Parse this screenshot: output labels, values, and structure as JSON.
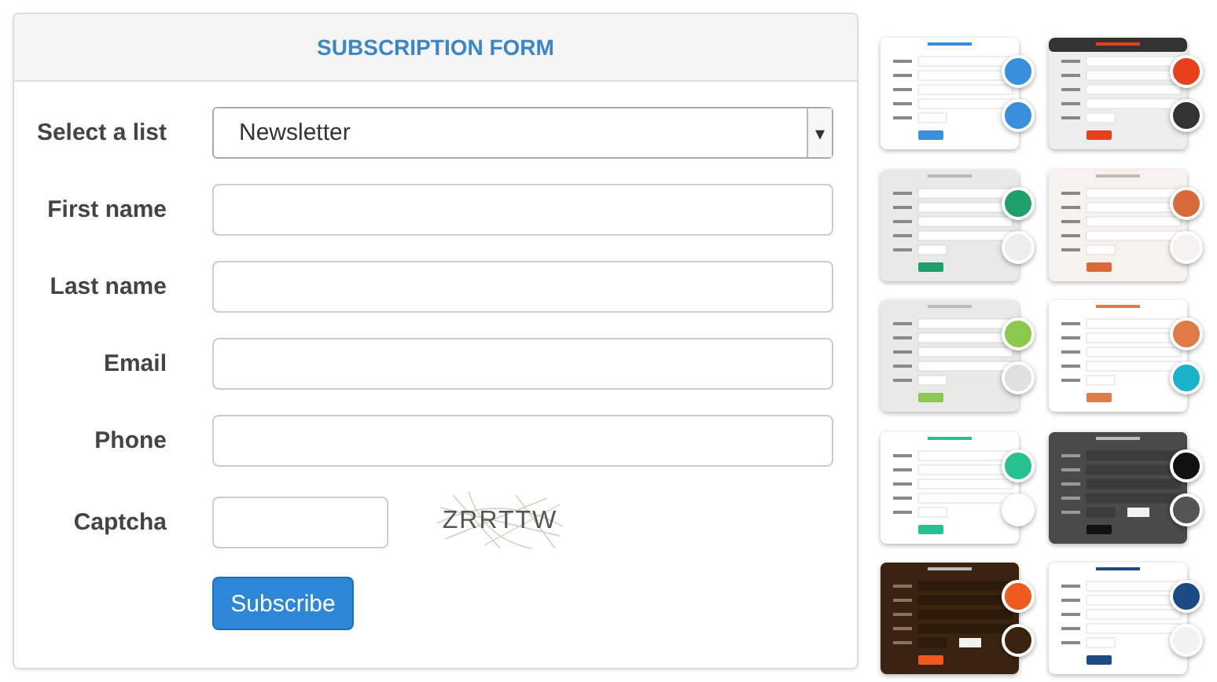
{
  "form": {
    "title": "SUBSCRIPTION FORM",
    "list_field": {
      "label": "Select a list",
      "value": "Newsletter",
      "caret": "▾"
    },
    "fields": [
      {
        "label": "First name"
      },
      {
        "label": "Last name"
      },
      {
        "label": "Email"
      },
      {
        "label": "Phone"
      }
    ],
    "captcha": {
      "label": "Captcha",
      "code": "ZRRTTW"
    },
    "submit": "Subscribe"
  },
  "themes": [
    {
      "kind": "light",
      "swatches": [
        {
          "color": "#3a8fdc"
        },
        {
          "color": "#3a8fdc"
        }
      ]
    },
    {
      "kind": "dark-header",
      "swatches": [
        {
          "color": "#e8401c"
        },
        {
          "color": "#333333"
        }
      ]
    },
    {
      "kind": "grey",
      "swatches": [
        {
          "color": "#1fa06a"
        },
        {
          "color": "#eeeeee"
        }
      ]
    },
    {
      "kind": "cream",
      "swatches": [
        {
          "color": "#d9693a"
        },
        {
          "color": "#f5f3ef"
        }
      ]
    },
    {
      "kind": "grey",
      "swatches": [
        {
          "color": "#8cc84b"
        },
        {
          "color": "#e0e0e0"
        }
      ]
    },
    {
      "kind": "light",
      "swatches": [
        {
          "color": "#e07b45"
        },
        {
          "color": "#1ab3c9"
        }
      ]
    },
    {
      "kind": "light",
      "swatches": [
        {
          "color": "#25c28f"
        },
        {
          "color": "#ffffff"
        }
      ]
    },
    {
      "kind": "dark",
      "swatches": [
        {
          "color": "#111111"
        },
        {
          "color": "#555555"
        }
      ]
    },
    {
      "kind": "brown",
      "swatches": [
        {
          "color": "#f05a1e"
        },
        {
          "color": "#3a2410"
        }
      ]
    },
    {
      "kind": "light",
      "swatches": [
        {
          "color": "#1c4a85"
        },
        {
          "color": "#f2f2f2"
        }
      ]
    }
  ]
}
